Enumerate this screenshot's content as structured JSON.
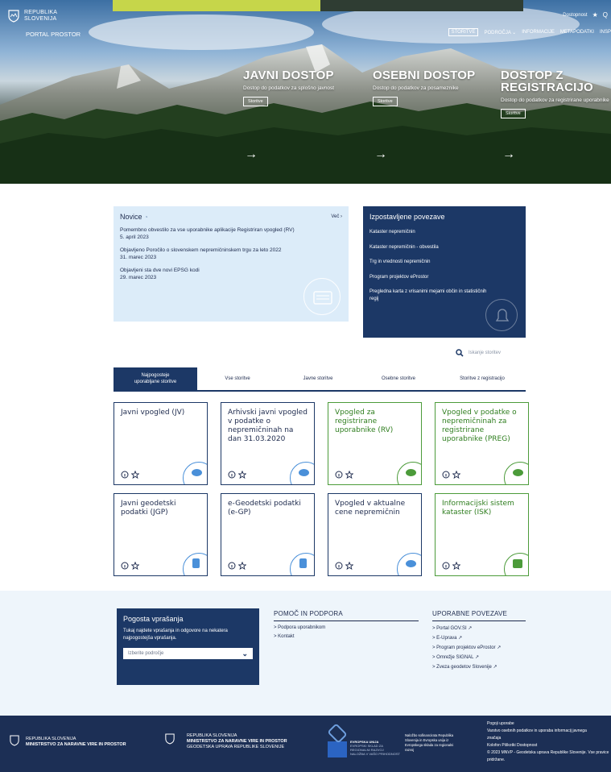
{
  "header": {
    "logo_line1": "REPUBLIKA",
    "logo_line2": "SLOVENIJA",
    "portal": "PORTAL PROSTOR",
    "util": [
      "Dostopnost",
      "★",
      "Q"
    ],
    "nav": [
      "STORITVE",
      "PODROČJA ⌄",
      "INFORMACIJE",
      "METAPODATKI",
      "INSP"
    ]
  },
  "hero": [
    {
      "title": "JAVNI DOSTOP",
      "sub": "Dostop do podatkov za splošno javnost",
      "btn": "Storitve",
      "arrow": "→"
    },
    {
      "title": "OSEBNI DOSTOP",
      "sub": "Dostop do podatkov za posameznike",
      "btn": "Storitve",
      "arrow": "→"
    },
    {
      "title_l1": "DOSTOP Z",
      "title_l2": "REGISTRACIJO",
      "sub": "Dostop do podatkov za registrirane uporabnike",
      "btn": "Storitve",
      "arrow": "→"
    }
  ],
  "news": {
    "title": "Novice",
    "more": "Več ›",
    "items": [
      {
        "text": "Pomembno obvestilo za vse uporabnike aplikacije Registriran vpogled (RV)",
        "date": "5. april 2023"
      },
      {
        "text": "Objavljeno Poročilo o slovenskem nepremičninskem trgu za leto 2022",
        "date": "31. marec 2023"
      },
      {
        "text": "Objavljeni sta dve novi EPSG kodi",
        "date": "29. marec 2023"
      }
    ]
  },
  "links": {
    "title": "Izpostavljene povezave",
    "items": [
      "Kataster nepremičnin",
      "Kataster nepremičnin - obvestila",
      "Trg in vrednosti nepremičnin",
      "Program projektov eProstor",
      "Pregledna karta z vrisanimi mejami občin in statističnih regij"
    ]
  },
  "search": {
    "placeholder": "Iskanje storitev"
  },
  "tabs": [
    {
      "l1": "Najpogosteje",
      "l2": "uporabljane storitve"
    },
    {
      "l1": "Vse storitve",
      "l2": ""
    },
    {
      "l1": "Javne storitve",
      "l2": ""
    },
    {
      "l1": "Osebne storitve",
      "l2": ""
    },
    {
      "l1": "Storitve z registracijo",
      "l2": ""
    }
  ],
  "cards": [
    {
      "title": "Javni vpogled (JV)"
    },
    {
      "title": "Arhivski javni vpogled v podatke o nepremičninah na dan 31.03.2020"
    },
    {
      "title": "Vpogled za registrirane uporabnike (RV)"
    },
    {
      "title": "Vpogled v podatke o nepremičninah za registrirane uporabnike (PREG)"
    },
    {
      "title": "Javni geodetski podatki (JGP)"
    },
    {
      "title": "e-Geodetski podatki (e-GP)"
    },
    {
      "title": "Vpogled v aktualne cene nepremičnin"
    },
    {
      "title": "Informacijski sistem kataster (ISK)"
    }
  ],
  "faq": {
    "title": "Pogosta vprašanja",
    "desc": "Tukaj najdete vprašanja in odgovore na nekatera najpogostejša vprašanja.",
    "select": "Izberite področje"
  },
  "help": {
    "title": "POMOČ IN PODPORA",
    "items": [
      "> Podpora uporabnikom",
      "> Kontakt"
    ]
  },
  "useful": {
    "title": "UPORABNE POVEZAVE",
    "items": [
      "> Portal GOV.SI ↗",
      "> E-Uprava ↗",
      "> Program projektov eProstor ↗",
      "> Omrežje SIGNAL ↗",
      "> Zveza geodetov Slovenije ↗"
    ]
  },
  "footer": {
    "m1_l1": "REPUBLIKA SLOVENIJA",
    "m1_l2": "MINISTRSTVO ZA NARAVNE VIRE IN PROSTOR",
    "m2_l1": "REPUBLIKA SLOVENIJA",
    "m2_l2": "MINISTRSTVO ZA NARAVNE VIRE IN PROSTOR",
    "m2_l3": "GEODETSKA UPRAVA REPUBLIKE SLOVENIJE",
    "eu_l1": "EVROPSKA UNIJA",
    "eu_l2": "EVROPSKI SKLAD ZA",
    "eu_l3": "REGIONALNI RAZVOJ",
    "eu_l4": "NALOŽBA V VAŠO PRIHODNOST",
    "cofund_l1": "Naložbo sofinancirata Republika",
    "cofund_l2": "Slovenija in Evropska unija iz",
    "cofund_l3": "Evropskega sklada za regionalni",
    "cofund_l4": "razvoj",
    "right_l1": "Pogoji uporabe",
    "right_l2": "Varstvo osebnih podatkov in uporaba informacij javnega",
    "right_l3": "značaja",
    "right_l4": "Kolofon   Piškotki   Dostopnost",
    "right_l5": "© 2023 MNVP - Geodetska uprava Republike Slovenije. Vse pravice",
    "right_l6": "pridržane."
  }
}
